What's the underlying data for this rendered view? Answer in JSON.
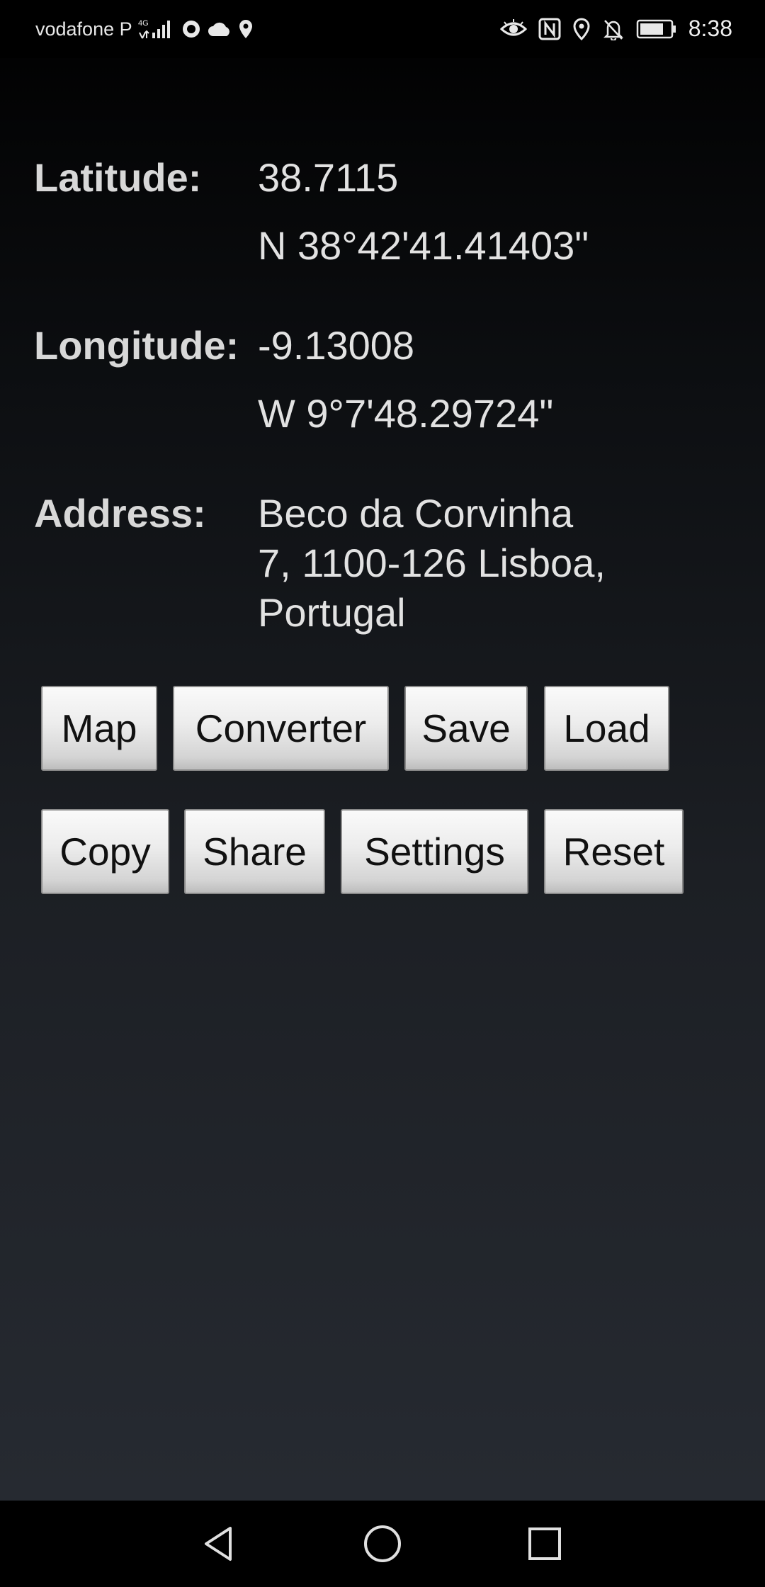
{
  "status_bar": {
    "carrier": "vodafone P",
    "network": "4G",
    "time": "8:38",
    "icons_left": [
      "signal-icon",
      "circle-icon",
      "cloud-icon",
      "location-icon"
    ],
    "icons_right": [
      "eye-icon",
      "nfc-icon",
      "location-icon",
      "bell-off-icon",
      "battery-icon"
    ]
  },
  "latitude": {
    "label": "Latitude:",
    "decimal": "38.7115",
    "dms": "N 38°42'41.41403\""
  },
  "longitude": {
    "label": "Longitude:",
    "decimal": "-9.13008",
    "dms": "W 9°7'48.29724\""
  },
  "address": {
    "label": "Address:",
    "lines": [
      "Beco da Corvinha",
      "7, 1100-126 Lisboa,",
      "Portugal"
    ]
  },
  "buttons": {
    "row1": [
      "Map",
      "Converter",
      "Save",
      "Load"
    ],
    "row2": [
      "Copy",
      "Share",
      "Settings",
      "Reset"
    ]
  },
  "nav": [
    "back-icon",
    "home-icon",
    "recents-icon"
  ]
}
